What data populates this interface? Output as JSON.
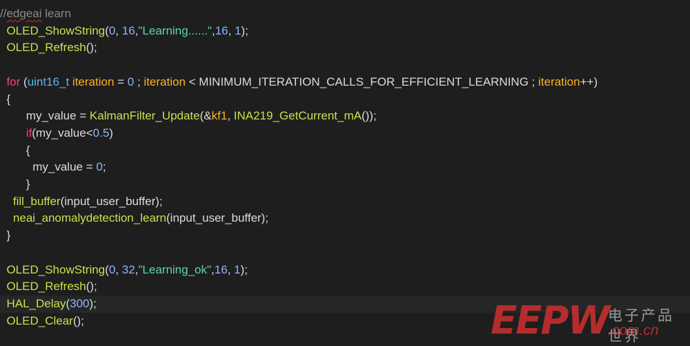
{
  "editor": {
    "lines": [
      [
        {
          "t": "comment",
          "v": "//"
        },
        {
          "t": "comment squiggle",
          "v": "edgeai"
        },
        {
          "t": "comment",
          "v": " learn"
        }
      ],
      [
        {
          "t": "plain",
          "v": "  "
        },
        {
          "t": "fn",
          "v": "OLED_ShowString"
        },
        {
          "t": "plain",
          "v": "("
        },
        {
          "t": "num",
          "v": "0"
        },
        {
          "t": "plain",
          "v": ", "
        },
        {
          "t": "num",
          "v": "16"
        },
        {
          "t": "plain",
          "v": ","
        },
        {
          "t": "str",
          "v": "\"Learning......\""
        },
        {
          "t": "plain",
          "v": ","
        },
        {
          "t": "num",
          "v": "16"
        },
        {
          "t": "plain",
          "v": ", "
        },
        {
          "t": "num",
          "v": "1"
        },
        {
          "t": "plain",
          "v": ");"
        }
      ],
      [
        {
          "t": "plain",
          "v": "  "
        },
        {
          "t": "fn",
          "v": "OLED_Refresh"
        },
        {
          "t": "plain",
          "v": "();"
        }
      ],
      [],
      [
        {
          "t": "plain",
          "v": "  "
        },
        {
          "t": "kw",
          "v": "for"
        },
        {
          "t": "plain",
          "v": " ("
        },
        {
          "t": "type",
          "v": "uint16_t"
        },
        {
          "t": "plain",
          "v": " "
        },
        {
          "t": "var",
          "v": "iteration"
        },
        {
          "t": "plain",
          "v": " = "
        },
        {
          "t": "num",
          "v": "0"
        },
        {
          "t": "plain",
          "v": " ; "
        },
        {
          "t": "var",
          "v": "iteration"
        },
        {
          "t": "plain",
          "v": " < MINIMUM_ITERATION_CALLS_FOR_EFFICIENT_LEARNING ; "
        },
        {
          "t": "var",
          "v": "iteration"
        },
        {
          "t": "plain",
          "v": "++)"
        }
      ],
      [
        {
          "t": "plain",
          "v": "  {"
        }
      ],
      [
        {
          "t": "plain",
          "v": "        my_value = "
        },
        {
          "t": "fn",
          "v": "KalmanFilter_Update"
        },
        {
          "t": "plain",
          "v": "(&"
        },
        {
          "t": "var",
          "v": "kf1"
        },
        {
          "t": "plain",
          "v": ", "
        },
        {
          "t": "fn",
          "v": "INA219_GetCurrent_mA"
        },
        {
          "t": "plain",
          "v": "());"
        }
      ],
      [
        {
          "t": "plain",
          "v": "        "
        },
        {
          "t": "kw",
          "v": "if"
        },
        {
          "t": "plain",
          "v": "(my_value<"
        },
        {
          "t": "num",
          "v": "0.5"
        },
        {
          "t": "plain",
          "v": ")"
        }
      ],
      [
        {
          "t": "plain",
          "v": "        {"
        }
      ],
      [
        {
          "t": "plain",
          "v": "          my_value = "
        },
        {
          "t": "num",
          "v": "0"
        },
        {
          "t": "plain",
          "v": ";"
        }
      ],
      [
        {
          "t": "plain",
          "v": "        }"
        }
      ],
      [
        {
          "t": "plain",
          "v": "    "
        },
        {
          "t": "fn",
          "v": "fill_buffer"
        },
        {
          "t": "plain",
          "v": "(input_user_buffer);"
        }
      ],
      [
        {
          "t": "plain",
          "v": "    "
        },
        {
          "t": "fn",
          "v": "neai_anomalydetection_learn"
        },
        {
          "t": "plain",
          "v": "(input_user_buffer);"
        }
      ],
      [
        {
          "t": "plain",
          "v": "  }"
        }
      ],
      [],
      [
        {
          "t": "plain",
          "v": "  "
        },
        {
          "t": "fn",
          "v": "OLED_ShowString"
        },
        {
          "t": "plain",
          "v": "("
        },
        {
          "t": "num",
          "v": "0"
        },
        {
          "t": "plain",
          "v": ", "
        },
        {
          "t": "num",
          "v": "32"
        },
        {
          "t": "plain",
          "v": ","
        },
        {
          "t": "str",
          "v": "\"Learning_ok\""
        },
        {
          "t": "plain",
          "v": ","
        },
        {
          "t": "num",
          "v": "16"
        },
        {
          "t": "plain",
          "v": ", "
        },
        {
          "t": "num",
          "v": "1"
        },
        {
          "t": "plain",
          "v": ");"
        }
      ],
      [
        {
          "t": "plain",
          "v": "  "
        },
        {
          "t": "fn",
          "v": "OLED_Refresh"
        },
        {
          "t": "plain",
          "v": "();"
        }
      ],
      [
        {
          "t": "plain",
          "v": "  "
        },
        {
          "t": "fn",
          "v": "HAL_Delay"
        },
        {
          "t": "plain",
          "v": "("
        },
        {
          "t": "num",
          "v": "300"
        },
        {
          "t": "plain",
          "v": ");"
        }
      ],
      [
        {
          "t": "plain",
          "v": "  "
        },
        {
          "t": "fn",
          "v": "OLED_Clear"
        },
        {
          "t": "plain",
          "v": "();"
        }
      ]
    ],
    "current_line": 17
  },
  "watermark": {
    "logo": "EEPW",
    "cn": "电子产品世界",
    "domain": ".com.cn"
  },
  "colors": {
    "background": "#1e1e1e",
    "function": "#c4e44f",
    "number": "#8fb6ff",
    "string": "#5fd3bd",
    "keyword": "#ff3f73",
    "type": "#59b8ea",
    "variable": "#ffb224",
    "comment": "#8a8a8a",
    "brand": "#cf2f2f"
  }
}
